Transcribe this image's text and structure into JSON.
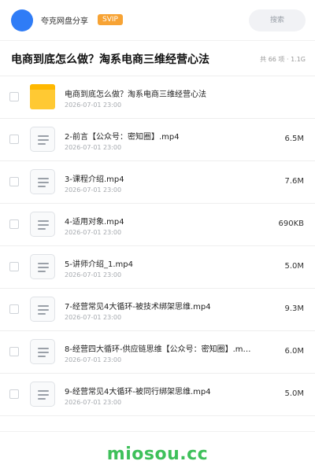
{
  "header": {
    "app_name": "夸克网盘分享",
    "badge": "SVIP",
    "search_label": "搜索"
  },
  "titlebar": {
    "title": "电商到底怎么做？淘系电商三维经营心法",
    "meta": "共 66 项 · 1.1G"
  },
  "items": [
    {
      "type": "folder",
      "name": "电商到底怎么做？淘系电商三维经营心法",
      "date": "2026-07-01 23:00",
      "size": ""
    },
    {
      "type": "file",
      "name": "2-前言【公众号：密知圈】.mp4",
      "date": "2026-07-01 23:00",
      "size": "6.5M"
    },
    {
      "type": "file",
      "name": "3-课程介绍.mp4",
      "date": "2026-07-01 23:00",
      "size": "7.6M"
    },
    {
      "type": "file",
      "name": "4-适用对象.mp4",
      "date": "2026-07-01 23:00",
      "size": "690KB"
    },
    {
      "type": "file",
      "name": "5-讲师介绍_1.mp4",
      "date": "2026-07-01 23:00",
      "size": "5.0M"
    },
    {
      "type": "file",
      "name": "7-经营常见4大循环-被技术绑架思维.mp4",
      "date": "2026-07-01 23:00",
      "size": "9.3M"
    },
    {
      "type": "file",
      "name": "8-经营四大循环-供应链思维【公众号：密知圈】.m…",
      "date": "2026-07-01 23:00",
      "size": "6.0M"
    },
    {
      "type": "file",
      "name": "9-经营常见4大循环-被同行绑架思维.mp4",
      "date": "2026-07-01 23:00",
      "size": "5.0M"
    }
  ],
  "footer": {
    "watermark": "miosou.cc"
  },
  "colors": {
    "accent": "#2f7cf6",
    "svip": "#f7a334",
    "folder": "#ffc933",
    "watermark": "#3ec05a"
  }
}
